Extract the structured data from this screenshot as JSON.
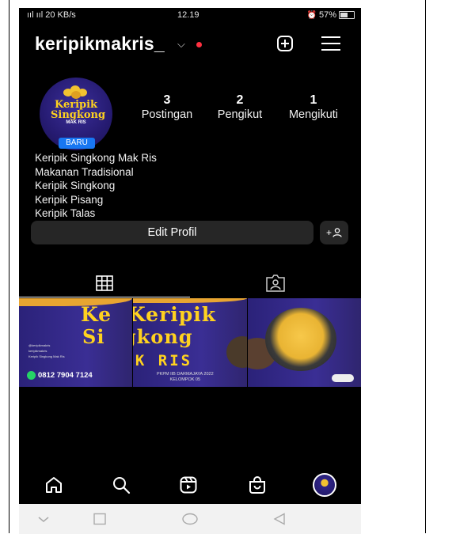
{
  "status_bar": {
    "signal": "ııl ııl 20 KB/s",
    "time": "12.19",
    "battery": "57%"
  },
  "profile": {
    "username": "keripikmakris_",
    "avatar_text": "Keripik Singkong",
    "avatar_subtext": "MAK RIS",
    "badge": "BARU",
    "stats": [
      {
        "value": "3",
        "label": "Postingan"
      },
      {
        "value": "2",
        "label": "Pengikut"
      },
      {
        "value": "1",
        "label": "Mengikuti"
      }
    ],
    "bio": [
      "Keripik Singkong Mak Ris",
      "Makanan Tradisional",
      "Keripik Singkong",
      "Keripik Pisang",
      "Keripik Talas"
    ],
    "edit_button": "Edit Profil",
    "add_person_label": "+"
  },
  "tabs": [
    {
      "icon": "grid-icon",
      "active": true
    },
    {
      "icon": "tagged-icon",
      "active": false
    }
  ],
  "post": {
    "title_line1": "Keripik",
    "title_line2": "Singkong",
    "brand": "MAK RIS",
    "phone": "0812 7904 7124",
    "social_lines": [
      "@keripikmakris",
      "keripikmakris",
      "Keripik Singkong Mak Ris"
    ],
    "footer_lines": [
      "PKPM IIB DARMAJAYA 2022",
      "KELOMPOK 05"
    ]
  },
  "bottom_nav": [
    "home-icon",
    "search-icon",
    "reels-icon",
    "shop-icon",
    "profile-avatar"
  ],
  "colors": {
    "background": "#000000",
    "badge": "#1877f2",
    "notification": "#ff3040",
    "brand_yellow": "#ffd21f",
    "banner_purple": "#2b2279"
  }
}
